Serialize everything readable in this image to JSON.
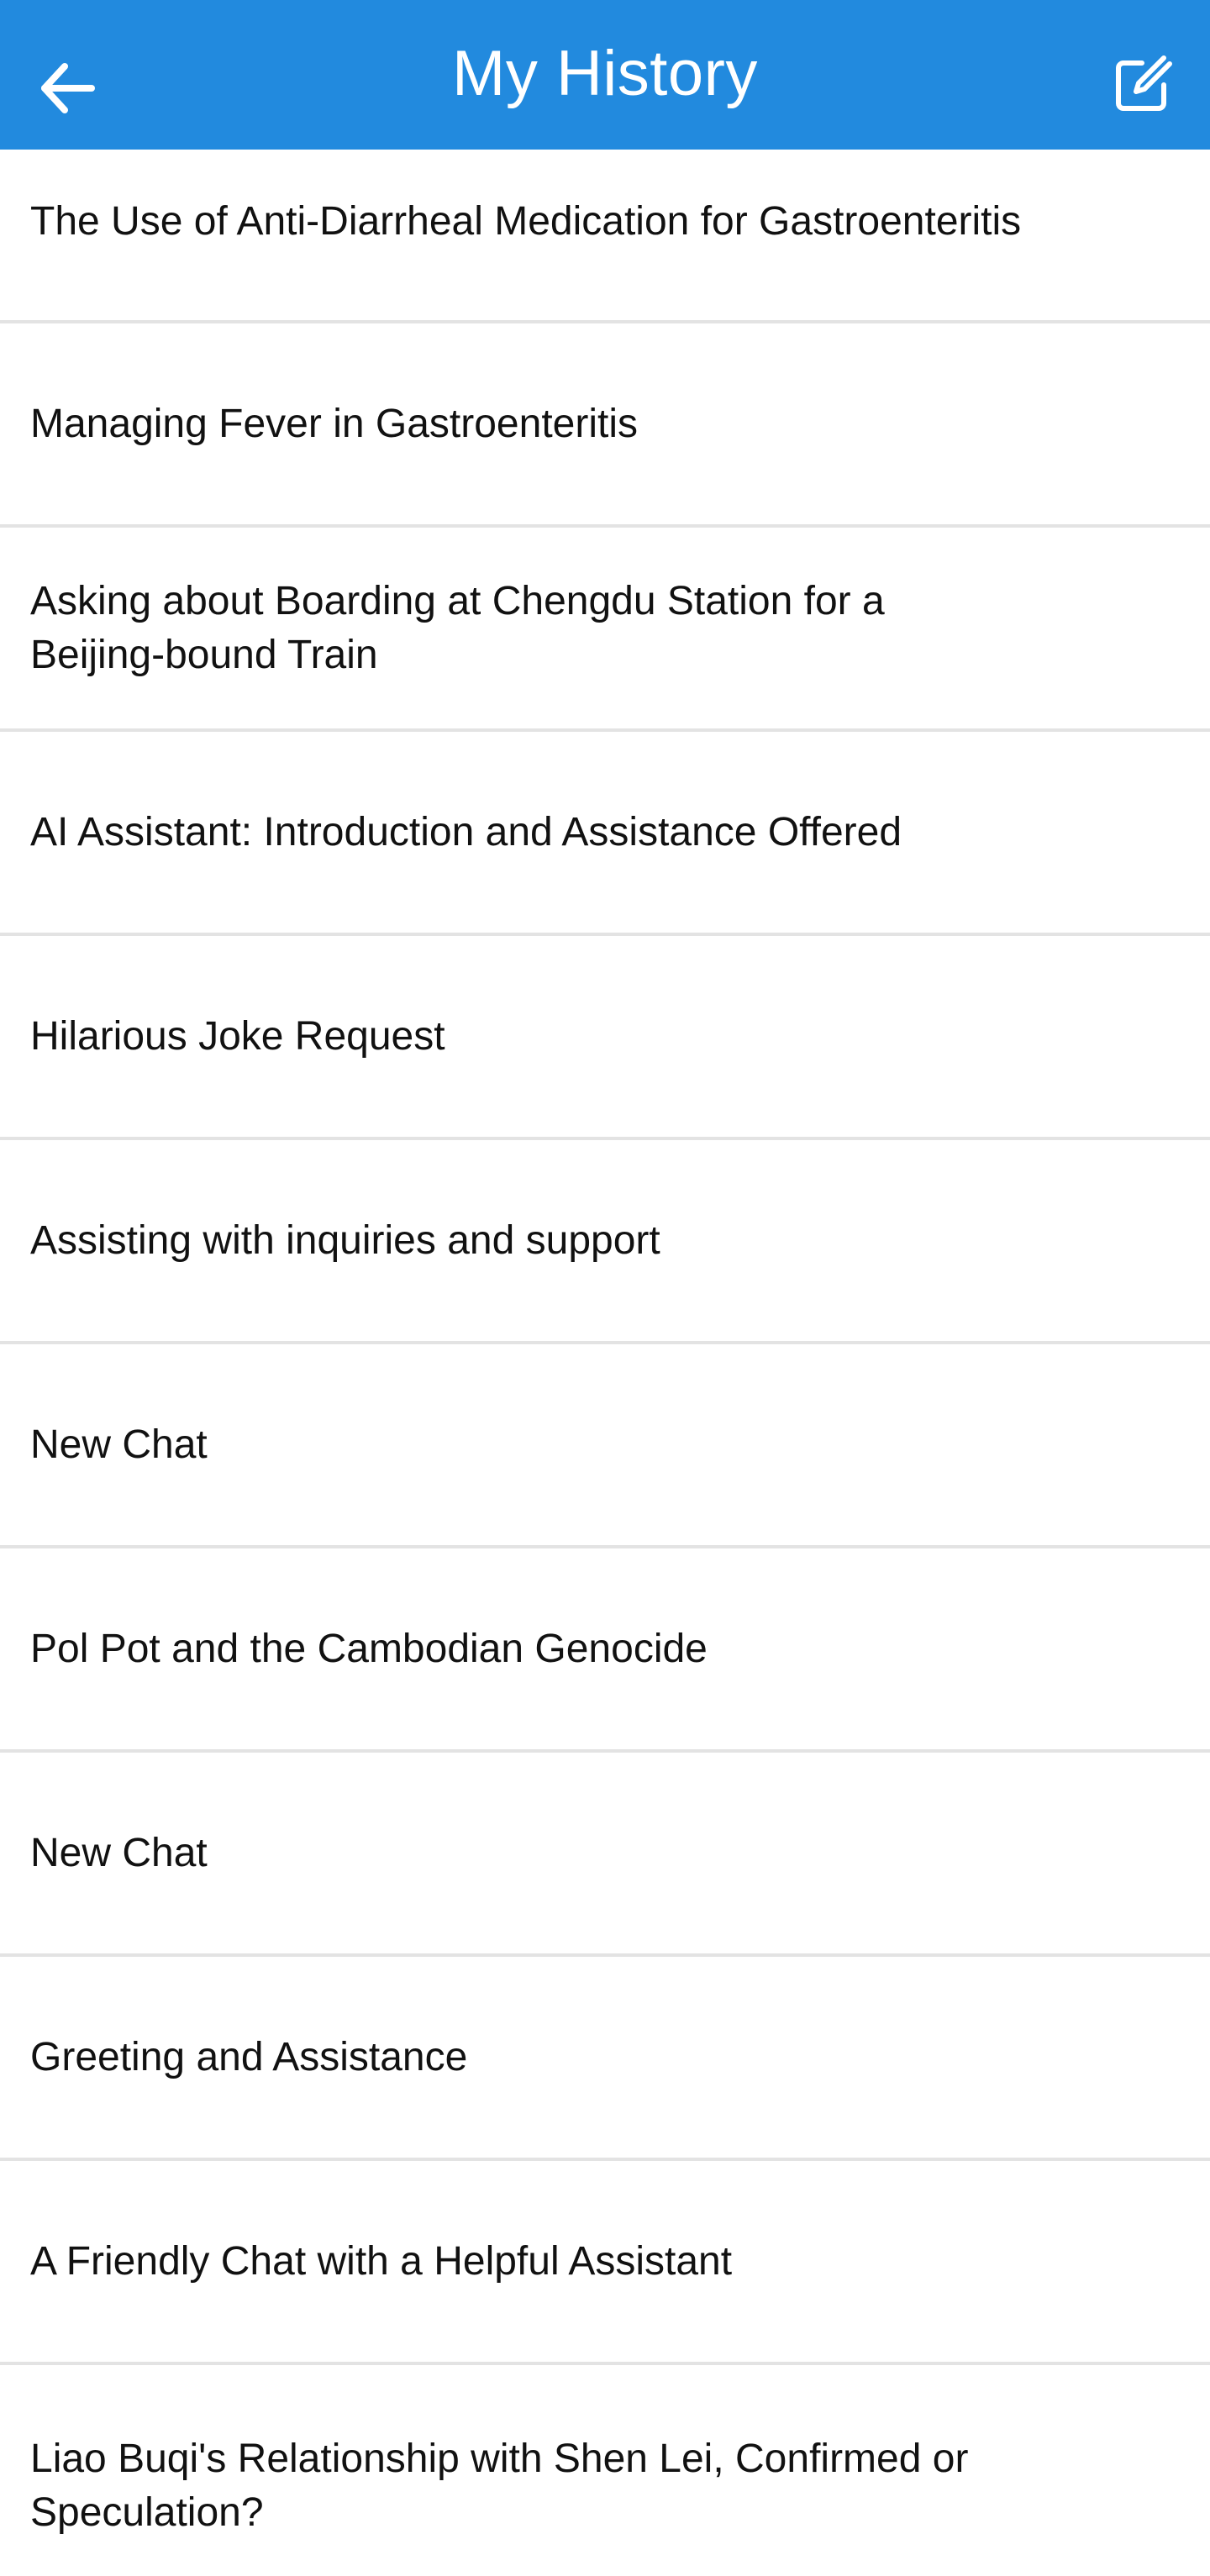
{
  "header": {
    "title": "My History",
    "background_color": "#228ADE",
    "back_icon": "arrow-left-icon",
    "edit_icon": "edit-square-icon"
  },
  "history": [
    {
      "label": "The Use of Anti-Diarrheal Medication for Gastroenteritis"
    },
    {
      "label": "Managing Fever in Gastroenteritis"
    },
    {
      "label": "Asking about Boarding at Chengdu Station for a Beijing-bound Train"
    },
    {
      "label": "AI Assistant: Introduction and Assistance Offered"
    },
    {
      "label": "Hilarious Joke Request"
    },
    {
      "label": "Assisting with inquiries and support"
    },
    {
      "label": "New Chat"
    },
    {
      "label": "Pol Pot and the Cambodian Genocide"
    },
    {
      "label": "New Chat"
    },
    {
      "label": "Greeting and Assistance"
    },
    {
      "label": "A Friendly Chat with a Helpful Assistant"
    },
    {
      "label": "Liao Buqi's Relationship with Shen Lei, Confirmed or Speculation?"
    }
  ]
}
